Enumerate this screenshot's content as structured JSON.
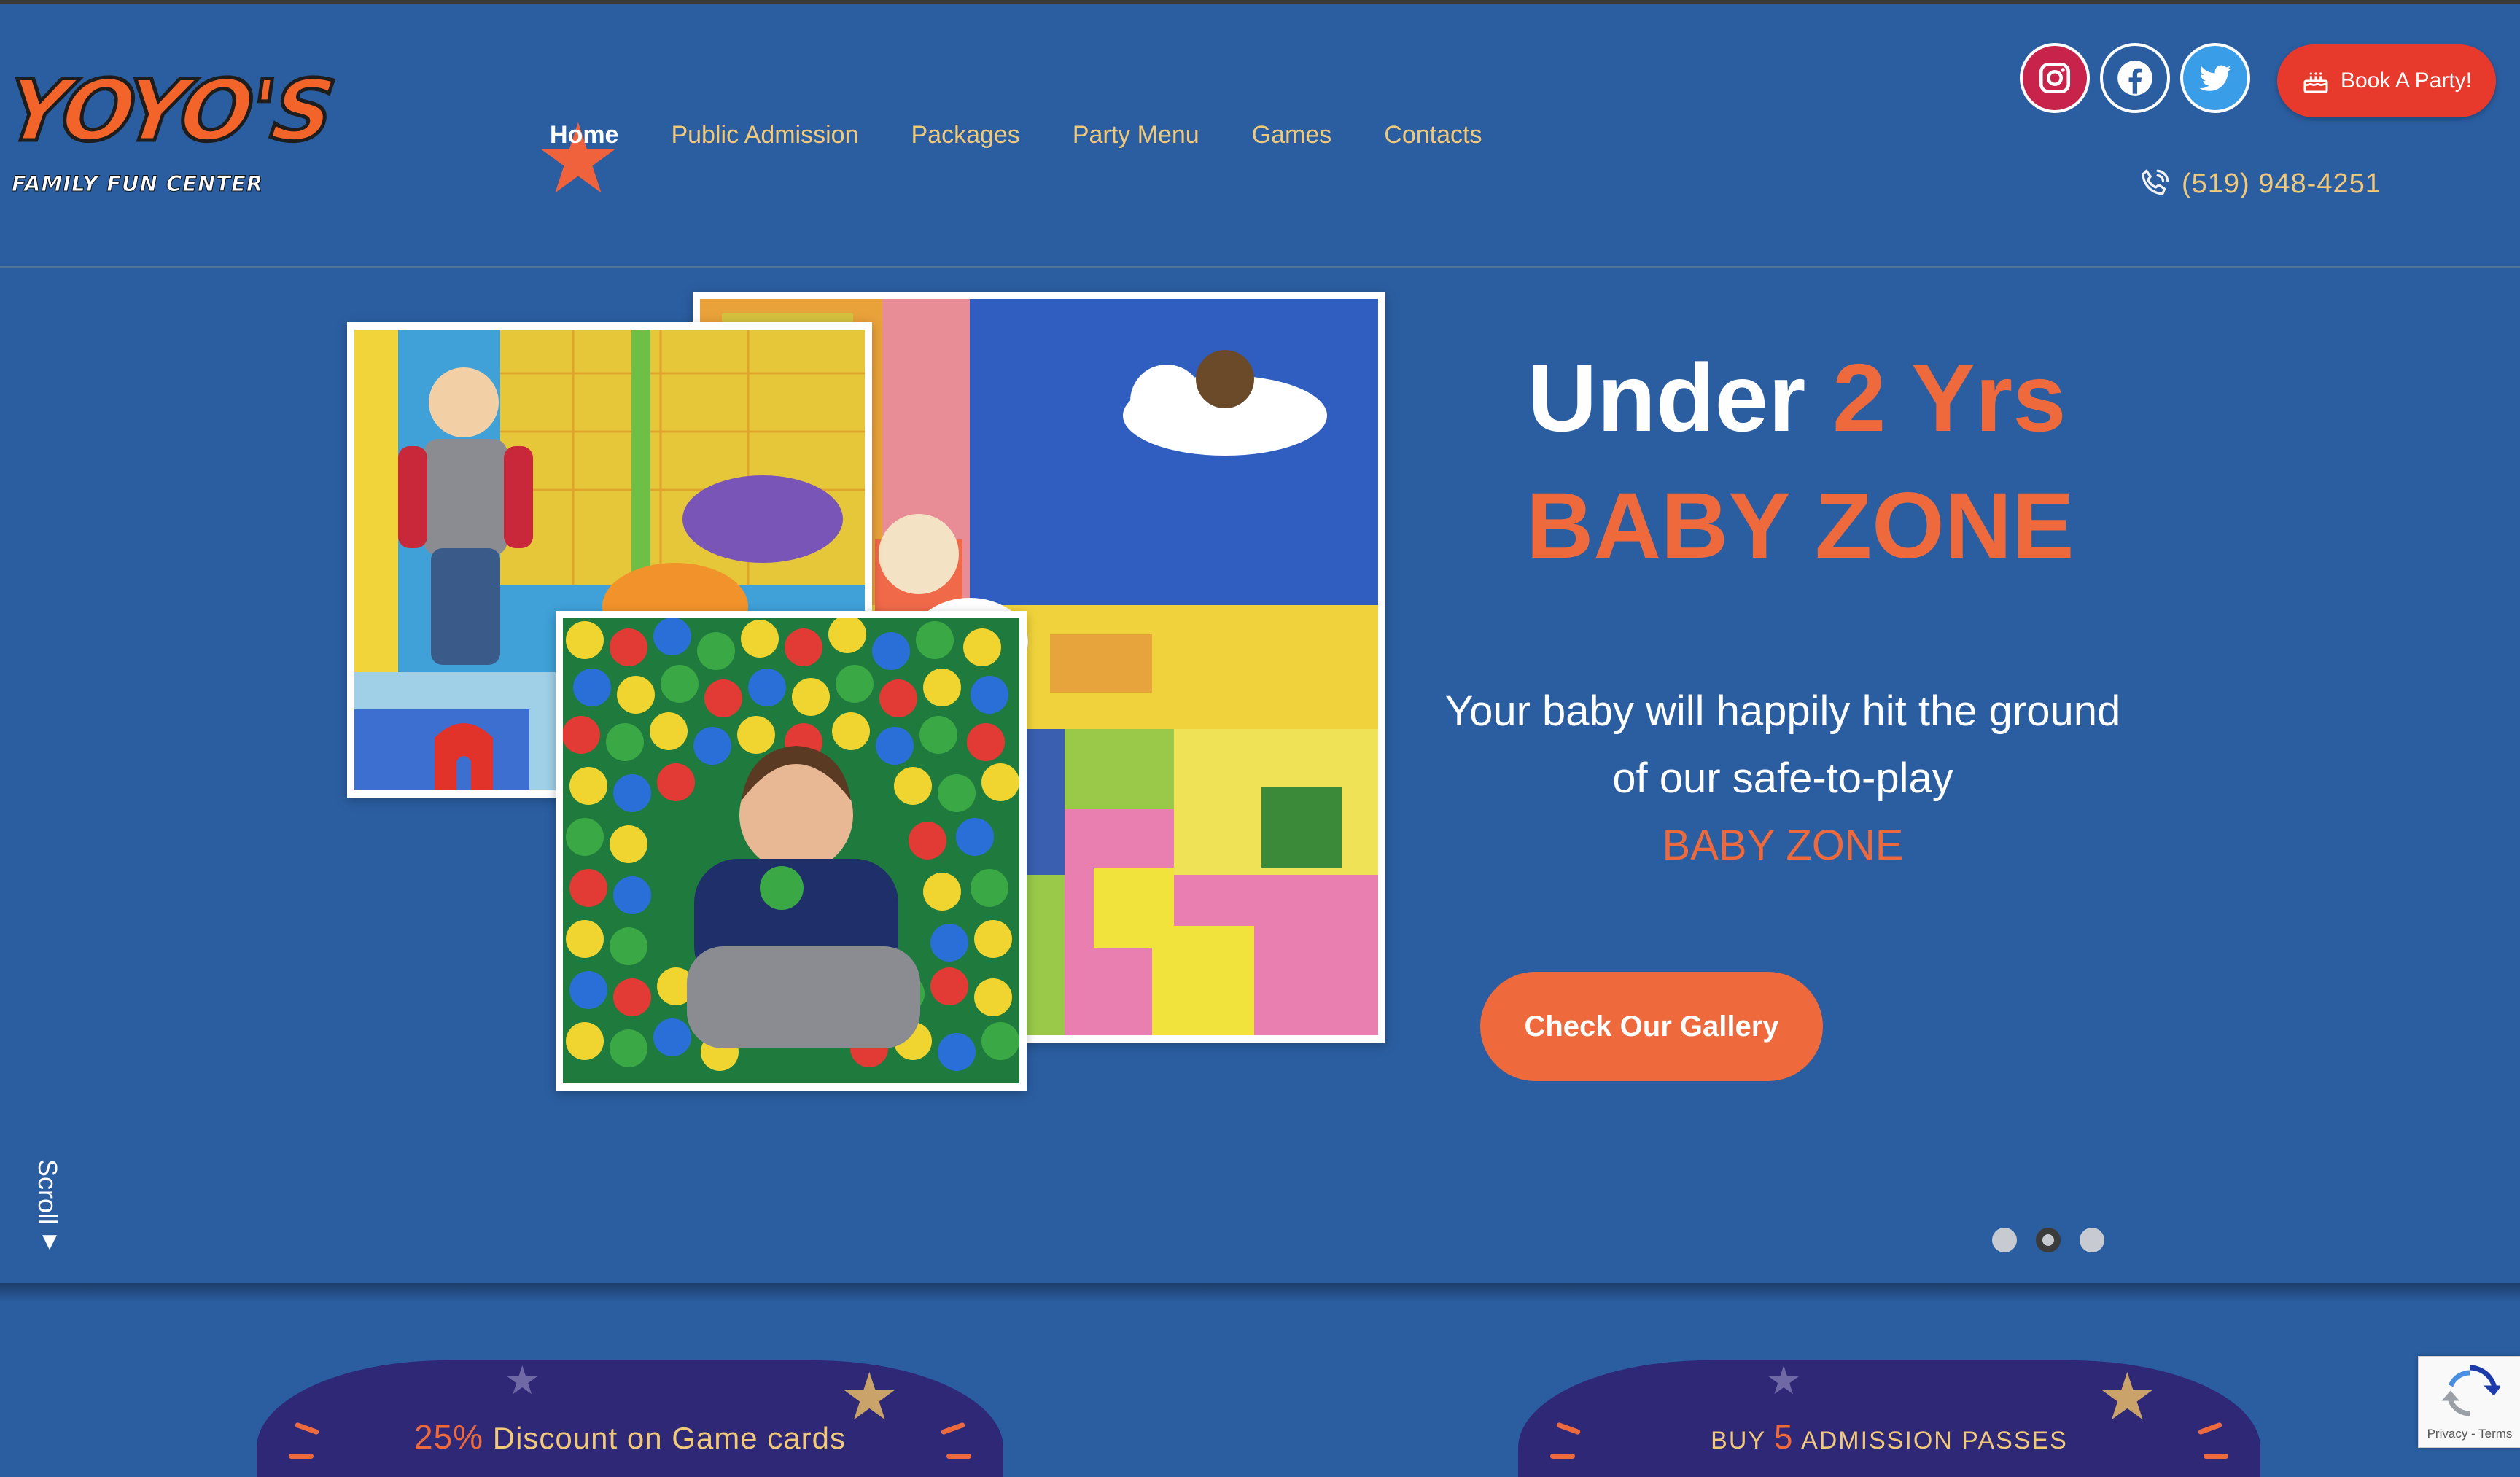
{
  "logo": {
    "main": "YOYO'S",
    "sub": "FAMILY FUN CENTER"
  },
  "nav": [
    {
      "label": "Home",
      "active": true
    },
    {
      "label": "Public Admission",
      "active": false
    },
    {
      "label": "Packages",
      "active": false
    },
    {
      "label": "Party Menu",
      "active": false
    },
    {
      "label": "Games",
      "active": false
    },
    {
      "label": "Contacts",
      "active": false
    }
  ],
  "social": {
    "instagram": "instagram-icon",
    "facebook": "facebook-icon",
    "twitter": "twitter-icon"
  },
  "book_button": "Book A Party!",
  "phone": "(519) 948-4251",
  "hero": {
    "title_prefix": "Under",
    "title_accent": "2 Yrs",
    "title_line2": "BABY ZONE",
    "desc_line1": "Your baby will happily hit the ground",
    "desc_line2": "of our safe-to-play",
    "desc_line3": "BABY ZONE",
    "cta": "Check Our Gallery",
    "scroll": "Scroll",
    "slides": 3,
    "active_slide": 2
  },
  "promos": [
    {
      "number": "25%",
      "text": "Discount on Game cards"
    },
    {
      "prefix": "BUY",
      "number": "5",
      "text": "ADMISSION PASSES"
    }
  ],
  "recaptcha": {
    "links": "Privacy - Terms"
  },
  "colors": {
    "background": "#2b5ea1",
    "accent": "#ee6a3d",
    "nav_text": "#f1c97a",
    "book": "#e8392d"
  }
}
